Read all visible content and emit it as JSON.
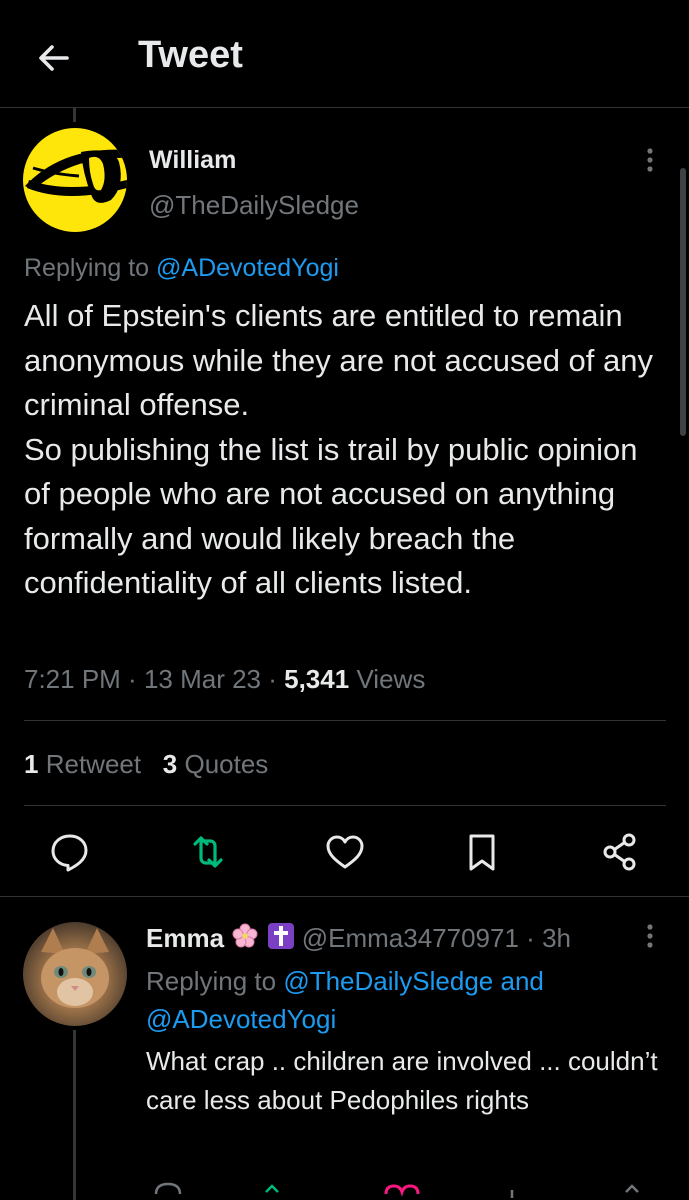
{
  "header": {
    "title": "Tweet"
  },
  "tweet": {
    "author_name": "William",
    "author_handle": "@TheDailySledge",
    "replying_prefix": "Replying to ",
    "replying_to": "@ADevotedYogi",
    "text": "All of Epstein's clients are entitled to remain anonymous while they are not accused of any criminal offense.\nSo publishing the list is trail by public opinion of people who are not accused on anything formally and would likely breach the confidentiality of all clients listed.",
    "time": "7:21 PM",
    "date": "13 Mar 23",
    "views_count": "5,341",
    "views_label": "Views",
    "retweets_count": "1",
    "retweets_label": "Retweet",
    "quotes_count": "3",
    "quotes_label": "Quotes"
  },
  "icons": {
    "back": "arrow-left-icon",
    "more": "more-vertical-icon",
    "reply": "comment-icon",
    "retweet": "retweet-icon",
    "like": "heart-icon",
    "bookmark": "bookmark-icon",
    "share": "share-icon"
  },
  "reply": {
    "author_name": "Emma",
    "author_handle": "@Emma34770971",
    "time_ago": "3h",
    "replying_prefix": "Replying to ",
    "replying_to_1": "@TheDailySledge",
    "replying_and": " and ",
    "replying_to_2": "@ADevotedYogi",
    "text": "What crap .. children are involved ... couldn’t care less about Pedophiles rights"
  },
  "colors": {
    "background": "#000000",
    "text": "#e7e9ea",
    "secondary": "#71767b",
    "link": "#1d9bf0",
    "retweet_active": "#00ba7c",
    "avatar_yellow": "#ffe60a"
  }
}
